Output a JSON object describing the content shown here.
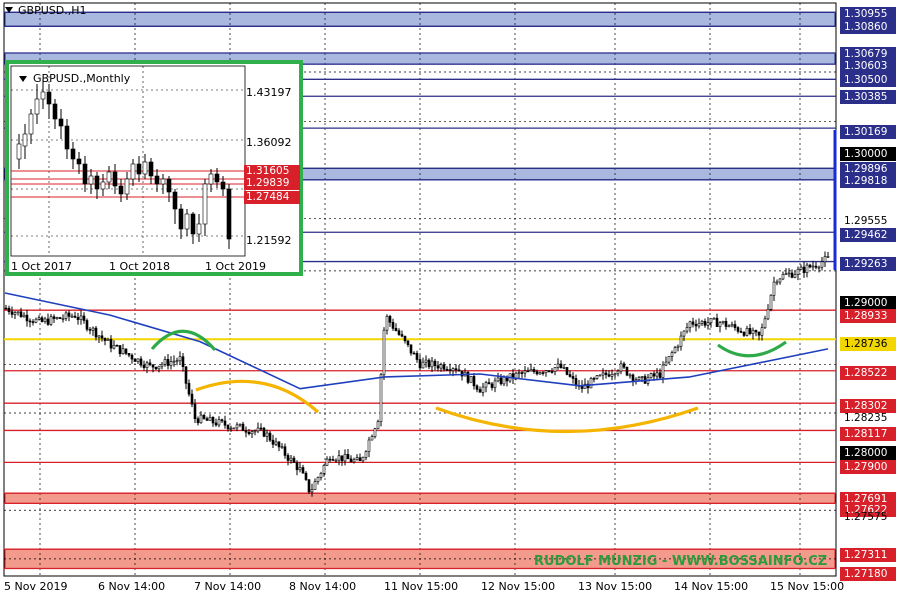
{
  "chart": {
    "symbol_label": "GBPUSD.,H1",
    "watermark": "RUDOLF MUNZIG - WWW.BOSSAINFO.CZ",
    "colors": {
      "grid": "#000000",
      "blue_level": "#2b2f8a",
      "red_level": "#d8202a",
      "yellow_level": "#f2d600",
      "ma": "#1f3fbf",
      "green_arc": "#2faa4a",
      "orange_arc": "#f4b400",
      "zone_blue": "#a9b8de",
      "zone_red": "#f29a8c",
      "label_black": "#000000",
      "label_blue": "#2b2f8a"
    }
  },
  "price_axis": {
    "labels": [
      {
        "text": "1.30955",
        "style": "blue"
      },
      {
        "text": "1.30860",
        "style": "blue"
      },
      {
        "text": "1.30679",
        "style": "blue"
      },
      {
        "text": "1.30603",
        "style": "blue"
      },
      {
        "text": "1.30500",
        "style": "blue"
      },
      {
        "text": "1.30385",
        "style": "blue"
      },
      {
        "text": "1.30169",
        "style": "blue"
      },
      {
        "text": "1.30000",
        "style": "black"
      },
      {
        "text": "1.29896",
        "style": "blue"
      },
      {
        "text": "1.29818",
        "style": "blue"
      },
      {
        "text": "1.29555",
        "style": "plain"
      },
      {
        "text": "1.29462",
        "style": "blue"
      },
      {
        "text": "1.29263",
        "style": "blue"
      },
      {
        "text": "1.29000",
        "style": "black"
      },
      {
        "text": "1.28933",
        "style": "red"
      },
      {
        "text": "1.28736",
        "style": "yellow"
      },
      {
        "text": "1.28522",
        "style": "red"
      },
      {
        "text": "1.28302",
        "style": "red"
      },
      {
        "text": "1.28235",
        "style": "plain"
      },
      {
        "text": "1.28117",
        "style": "red"
      },
      {
        "text": "1.28000",
        "style": "black"
      },
      {
        "text": "1.27900",
        "style": "red"
      },
      {
        "text": "1.27691",
        "style": "red"
      },
      {
        "text": "1.27622",
        "style": "red"
      },
      {
        "text": "1.27575",
        "style": "plain"
      },
      {
        "text": "1.27311",
        "style": "red"
      },
      {
        "text": "1.27180",
        "style": "red"
      }
    ]
  },
  "time_axis": {
    "labels": [
      "5 Nov 2019",
      "6 Nov 14:00",
      "7 Nov 14:00",
      "8 Nov 14:00",
      "11 Nov 15:00",
      "12 Nov 15:00",
      "13 Nov 15:00",
      "14 Nov 15:00",
      "15 Nov 15:00"
    ]
  },
  "inset": {
    "symbol_label": "GBPUSD.,Monthly",
    "price_labels": [
      "1.43197",
      "1.36092",
      "1.21592"
    ],
    "highlight_labels": [
      "1.31605",
      "1.29839",
      "1.27484"
    ],
    "time_labels": [
      "1 Oct 2017",
      "1 Oct 2018",
      "1 Oct 2019"
    ]
  },
  "chart_data": {
    "type": "candlestick",
    "title": "GBPUSD.,H1",
    "timeframe": "H1",
    "x_ticks": [
      "5 Nov 2019",
      "6 Nov 14:00",
      "7 Nov 14:00",
      "8 Nov 14:00",
      "11 Nov 15:00",
      "12 Nov 15:00",
      "13 Nov 15:00",
      "14 Nov 15:00",
      "15 Nov 15:00"
    ],
    "ylim": [
      1.2713,
      1.3099
    ],
    "resistance_zones": [
      [
        1.3086,
        1.30955
      ],
      [
        1.30603,
        1.30679
      ],
      [
        1.29818,
        1.29896
      ]
    ],
    "support_zones": [
      [
        1.27622,
        1.27691
      ],
      [
        1.2718,
        1.27311
      ]
    ],
    "blue_levels": [
      1.30955,
      1.3086,
      1.30679,
      1.30603,
      1.305,
      1.30385,
      1.30169,
      1.29896,
      1.29818,
      1.29462,
      1.29263
    ],
    "red_levels": [
      1.28933,
      1.28522,
      1.28302,
      1.28117,
      1.279,
      1.27691,
      1.27622,
      1.27311,
      1.2718
    ],
    "yellow_level": 1.28736,
    "round_levels": [
      1.3,
      1.29,
      1.28
    ],
    "last_price": 1.29263,
    "price_path_approx": [
      {
        "t": "5 Nov 2019",
        "close": 1.2895
      },
      {
        "t": "6 Nov 14:00",
        "close": 1.2865
      },
      {
        "t": "7 Nov 14:00",
        "close": 1.2815
      },
      {
        "t": "8 Nov 14:00",
        "close": 1.279
      },
      {
        "t": "11 Nov 15:00",
        "close": 1.2855
      },
      {
        "t": "12 Nov 15:00",
        "close": 1.2847
      },
      {
        "t": "13 Nov 15:00",
        "close": 1.284
      },
      {
        "t": "14 Nov 15:00",
        "close": 1.2875
      },
      {
        "t": "15 Nov 15:00",
        "close": 1.2926
      }
    ],
    "moving_average_approx": [
      {
        "t": "5 Nov 2019",
        "value": 1.2905
      },
      {
        "t": "6 Nov 14:00",
        "value": 1.289
      },
      {
        "t": "7 Nov 14:00",
        "value": 1.2872
      },
      {
        "t": "8 Nov 14:00",
        "value": 1.284
      },
      {
        "t": "11 Nov 15:00",
        "value": 1.2848
      },
      {
        "t": "12 Nov 15:00",
        "value": 1.285
      },
      {
        "t": "13 Nov 15:00",
        "value": 1.2842
      },
      {
        "t": "14 Nov 15:00",
        "value": 1.2848
      },
      {
        "t": "15 Nov 15:00",
        "value": 1.2867
      }
    ]
  }
}
